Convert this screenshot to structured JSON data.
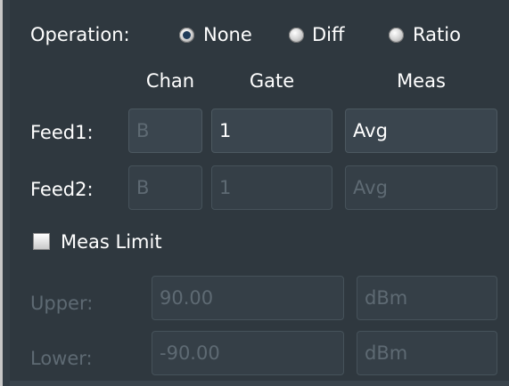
{
  "operation": {
    "label": "Operation:",
    "options": [
      {
        "label": "None",
        "checked": true
      },
      {
        "label": "Diff",
        "checked": false
      },
      {
        "label": "Ratio",
        "checked": false
      }
    ]
  },
  "columns": {
    "chan": "Chan",
    "gate": "Gate",
    "meas": "Meas"
  },
  "feed1": {
    "label": "Feed1:",
    "chan": "B",
    "gate": "1",
    "meas": "Avg"
  },
  "feed2": {
    "label": "Feed2:",
    "chan": "B",
    "gate": "1",
    "meas": "Avg"
  },
  "meas_limit": {
    "label": "Meas Limit",
    "checked": false
  },
  "upper": {
    "label": "Upper:",
    "value": "90.00",
    "unit": "dBm"
  },
  "lower": {
    "label": "Lower:",
    "value": "-90.00",
    "unit": "dBm"
  },
  "colors": {
    "panel_bg": "#2f383f",
    "field_bg": "#3a454e",
    "text": "#ffffff",
    "dim_text": "#5e6a73"
  }
}
